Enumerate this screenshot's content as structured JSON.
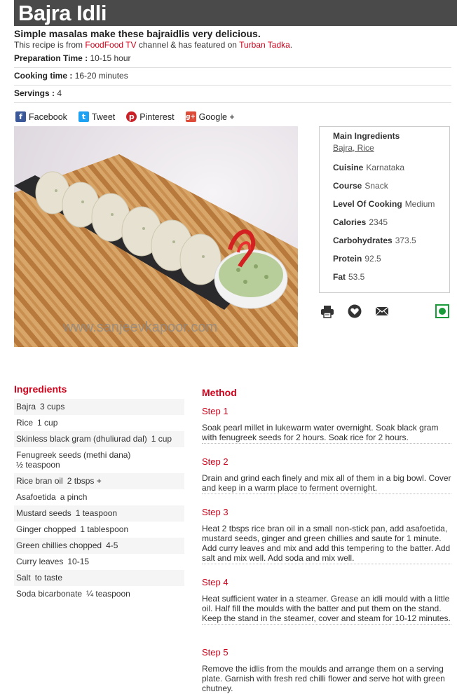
{
  "title": "Bajra Idli",
  "subtitle": "Simple masalas make these bajraidlis very delicious.",
  "source": {
    "prefix": "This recipe is from ",
    "channel": "FoodFood TV",
    "middle": " channel & has featured on ",
    "show": "Turban Tadka",
    "suffix": "."
  },
  "meta": {
    "prep_label": "Preparation Time :",
    "prep_value": "10-15 hour",
    "cook_label": "Cooking time :",
    "cook_value": "16-20 minutes",
    "serv_label": "Servings :",
    "serv_value": "4"
  },
  "share": {
    "facebook": "Facebook",
    "tweet": "Tweet",
    "pinterest": "Pinterest",
    "google": "Google +"
  },
  "image": {
    "watermark": "www.sanjeevkapoor.com"
  },
  "info": {
    "main_ingredients_label": "Main Ingredients",
    "main_ingredients_value": "Bajra, Rice",
    "cuisine_label": "Cuisine",
    "cuisine_value": "Karnataka",
    "course_label": "Course",
    "course_value": "Snack",
    "level_label": "Level Of Cooking",
    "level_value": "Medium",
    "calories_label": "Calories",
    "calories_value": "2345",
    "carbs_label": "Carbohydrates",
    "carbs_value": "373.5",
    "protein_label": "Protein",
    "protein_value": "92.5",
    "fat_label": "Fat",
    "fat_value": "53.5"
  },
  "tools": {
    "print": "print-icon",
    "favorite": "heart-icon",
    "email": "mail-icon",
    "veg": "veg-indicator-icon"
  },
  "ingredients": {
    "heading": "Ingredients",
    "items": [
      {
        "name": "Bajra",
        "qty": "3 cups"
      },
      {
        "name": "Rice",
        "qty": "1 cup"
      },
      {
        "name": "Skinless black gram (dhuliurad dal)",
        "qty": "1 cup"
      },
      {
        "name": "Fenugreek seeds (methi dana)",
        "qty": "½ teaspoon"
      },
      {
        "name": "Rice bran oil",
        "qty": "2 tbsps +"
      },
      {
        "name": "Asafoetida",
        "qty": "a pinch"
      },
      {
        "name": "Mustard seeds",
        "qty": "1 teaspoon"
      },
      {
        "name": "Ginger chopped",
        "qty": "1 tablespoon"
      },
      {
        "name": "Green chillies chopped",
        "qty": "4-5"
      },
      {
        "name": "Curry leaves",
        "qty": "10-15"
      },
      {
        "name": "Salt",
        "qty": "to taste"
      },
      {
        "name": "Soda bicarbonate",
        "qty": "¼ teaspoon"
      }
    ]
  },
  "method": {
    "heading": "Method",
    "steps": [
      {
        "label": "Step 1",
        "text": "Soak pearl millet in lukewarm water overnight. Soak black gram with fenugreek seeds for 2 hours. Soak rice for 2 hours."
      },
      {
        "label": "Step 2",
        "text": "Drain and grind each finely and mix all of them in a big bowl. Cover and keep in a warm place to ferment overnight."
      },
      {
        "label": "Step 3",
        "text": "Heat 2 tbsps rice bran oil in a small non-stick pan, add asafoetida, mustard seeds, ginger and green chillies and saute for 1 minute. Add curry leaves and mix and add this tempering to the batter. Add salt and mix well. Add soda and mix well."
      },
      {
        "label": "Step 4",
        "text": "Heat sufficient water in a steamer. Grease an idli mould with a little oil. Half fill the moulds with the batter and put them on the stand. Keep the stand in the steamer, cover and steam for 10-12 minutes."
      },
      {
        "label": "Step 5",
        "text": "Remove the idlis from the moulds and arrange them on a serving plate. Garnish with fresh red chilli flower and serve hot with green chutney."
      }
    ]
  },
  "colors": {
    "accent": "#d0021b",
    "title_bar": "#4a4a4a",
    "facebook": "#3b5998",
    "twitter": "#1da1f2",
    "pinterest": "#cb2027",
    "google": "#dd4b39",
    "veg": "#1a9b3a"
  }
}
